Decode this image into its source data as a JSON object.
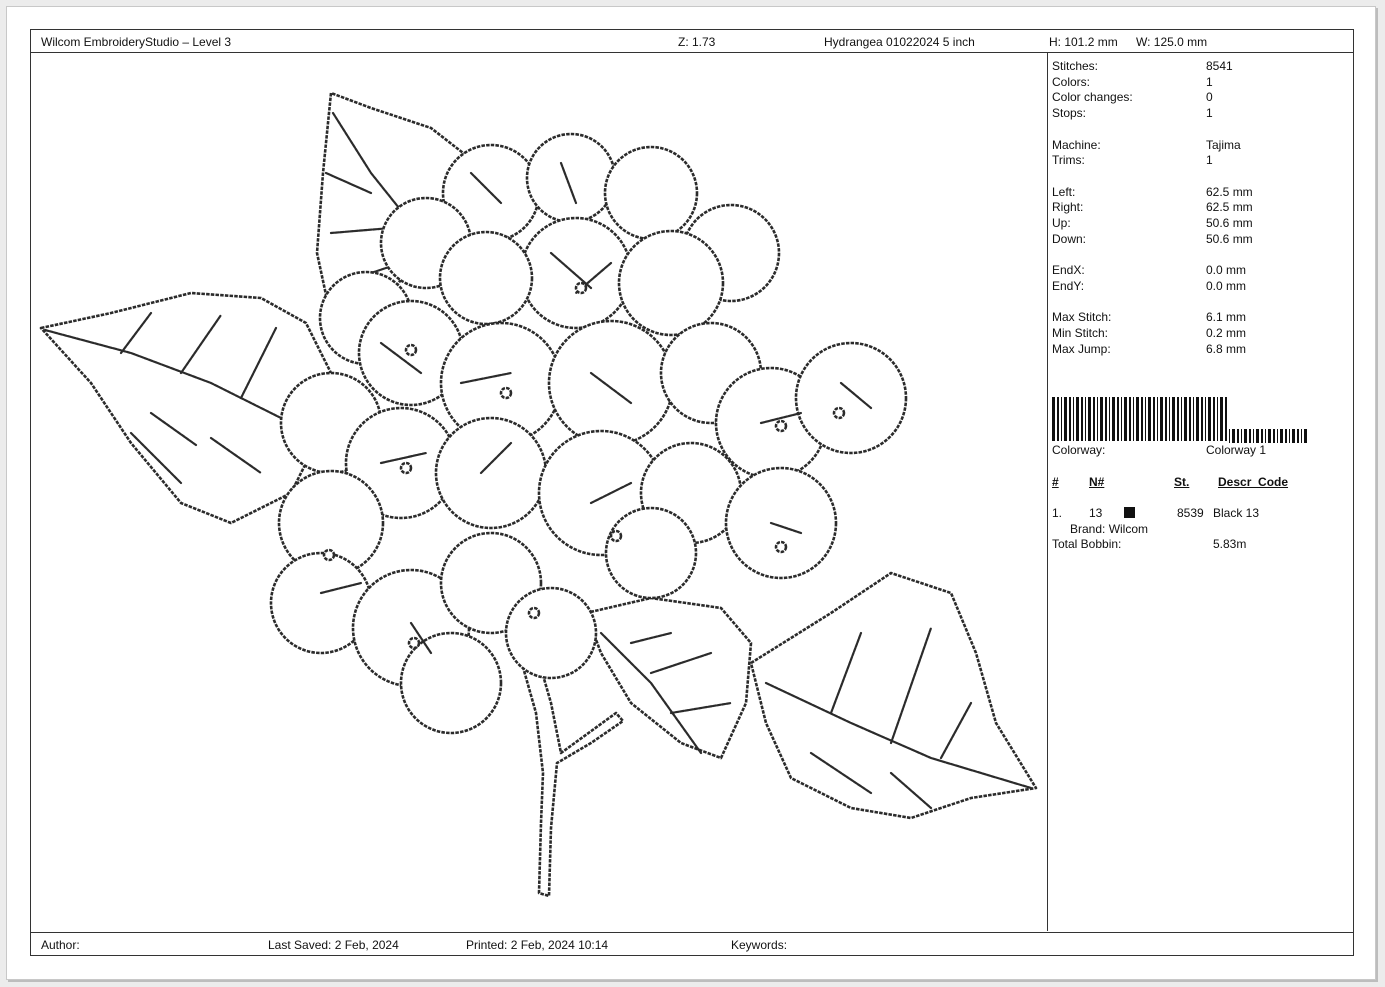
{
  "header": {
    "app_title": "Wilcom EmbroideryStudio – Level 3",
    "zoom": "Z: 1.73",
    "design_name": "Hydrangea 01022024 5 inch",
    "height": "H: 101.2 mm",
    "width": "W: 125.0 mm"
  },
  "stats": [
    {
      "label": "Stitches:",
      "value": "8541"
    },
    {
      "label": "Colors:",
      "value": "1"
    },
    {
      "label": "Color changes:",
      "value": "0"
    },
    {
      "label": "Stops:",
      "value": "1"
    },
    {
      "label": "Machine:",
      "value": "Tajima"
    },
    {
      "label": "Trims:",
      "value": "1"
    },
    {
      "label": "Left:",
      "value": "62.5 mm"
    },
    {
      "label": "Right:",
      "value": "62.5 mm"
    },
    {
      "label": "Up:",
      "value": "50.6 mm"
    },
    {
      "label": "Down:",
      "value": "50.6 mm"
    },
    {
      "label": "EndX:",
      "value": "0.0 mm"
    },
    {
      "label": "EndY:",
      "value": "0.0 mm"
    },
    {
      "label": "Max Stitch:",
      "value": "6.1 mm"
    },
    {
      "label": "Min Stitch:",
      "value": "0.2 mm"
    },
    {
      "label": "Max Jump:",
      "value": "6.8 mm"
    }
  ],
  "colorway": {
    "label": "Colorway:",
    "value": "Colorway 1"
  },
  "color_table": {
    "headers": {
      "num": "#",
      "needle": "N#",
      "stitches": "St.",
      "descr": "Descr_Code"
    },
    "rows": [
      {
        "num": "1.",
        "needle": "13",
        "swatch_color": "#111111",
        "stitches": "8539",
        "descr": "Black 13",
        "brand": "Brand: Wilcom"
      }
    ]
  },
  "bobbin": {
    "label": "Total Bobbin:",
    "value": "5.83m"
  },
  "footer": {
    "author": "Author:",
    "last_saved": "Last Saved:  2 Feb, 2024",
    "printed": "Printed:  2 Feb, 2024 10:14",
    "keywords": "Keywords:"
  }
}
